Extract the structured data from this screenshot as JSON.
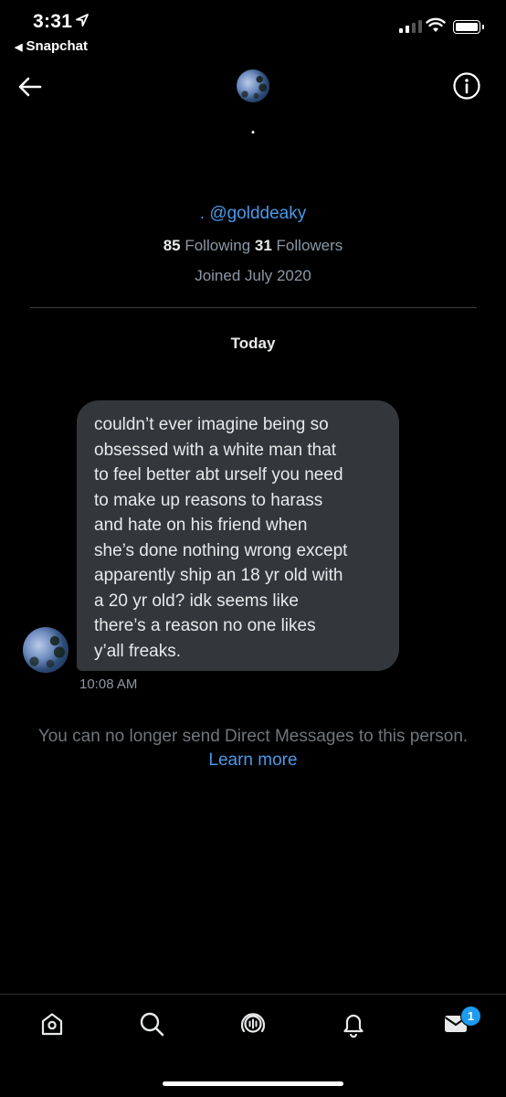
{
  "status_bar": {
    "time": "3:31",
    "back_app": "Snapchat"
  },
  "header": {
    "display_name": "."
  },
  "profile": {
    "name_dot": ".",
    "handle": "@golddeaky",
    "following_count": "85",
    "following_label": "Following",
    "followers_count": "31",
    "followers_label": "Followers",
    "joined": "Joined July 2020"
  },
  "conversation": {
    "date_separator": "Today",
    "messages": [
      {
        "lines": [
          "couldn’t ever imagine being so",
          "obsessed with a white man that",
          "to feel better abt urself you need",
          "to make up reasons to harass",
          "and hate on his friend when",
          "she’s done nothing wrong except",
          "apparently ship an 18 yr old with",
          "a 20 yr old? idk seems like",
          "there’s a reason no one likes",
          "y’all freaks."
        ],
        "time": "10:08 AM"
      }
    ],
    "notice": "You can no longer send Direct Messages to this person.",
    "learn_more": "Learn more"
  },
  "tab_bar": {
    "tabs": [
      "home-icon",
      "search-icon",
      "spaces-icon",
      "notifications-icon",
      "messages-icon"
    ],
    "messages_badge": "1"
  },
  "colors": {
    "background": "#000000",
    "accent": "#4a99e9",
    "bubble": "#33373b",
    "muted": "#8b98a5",
    "badge": "#1d9bf0"
  }
}
